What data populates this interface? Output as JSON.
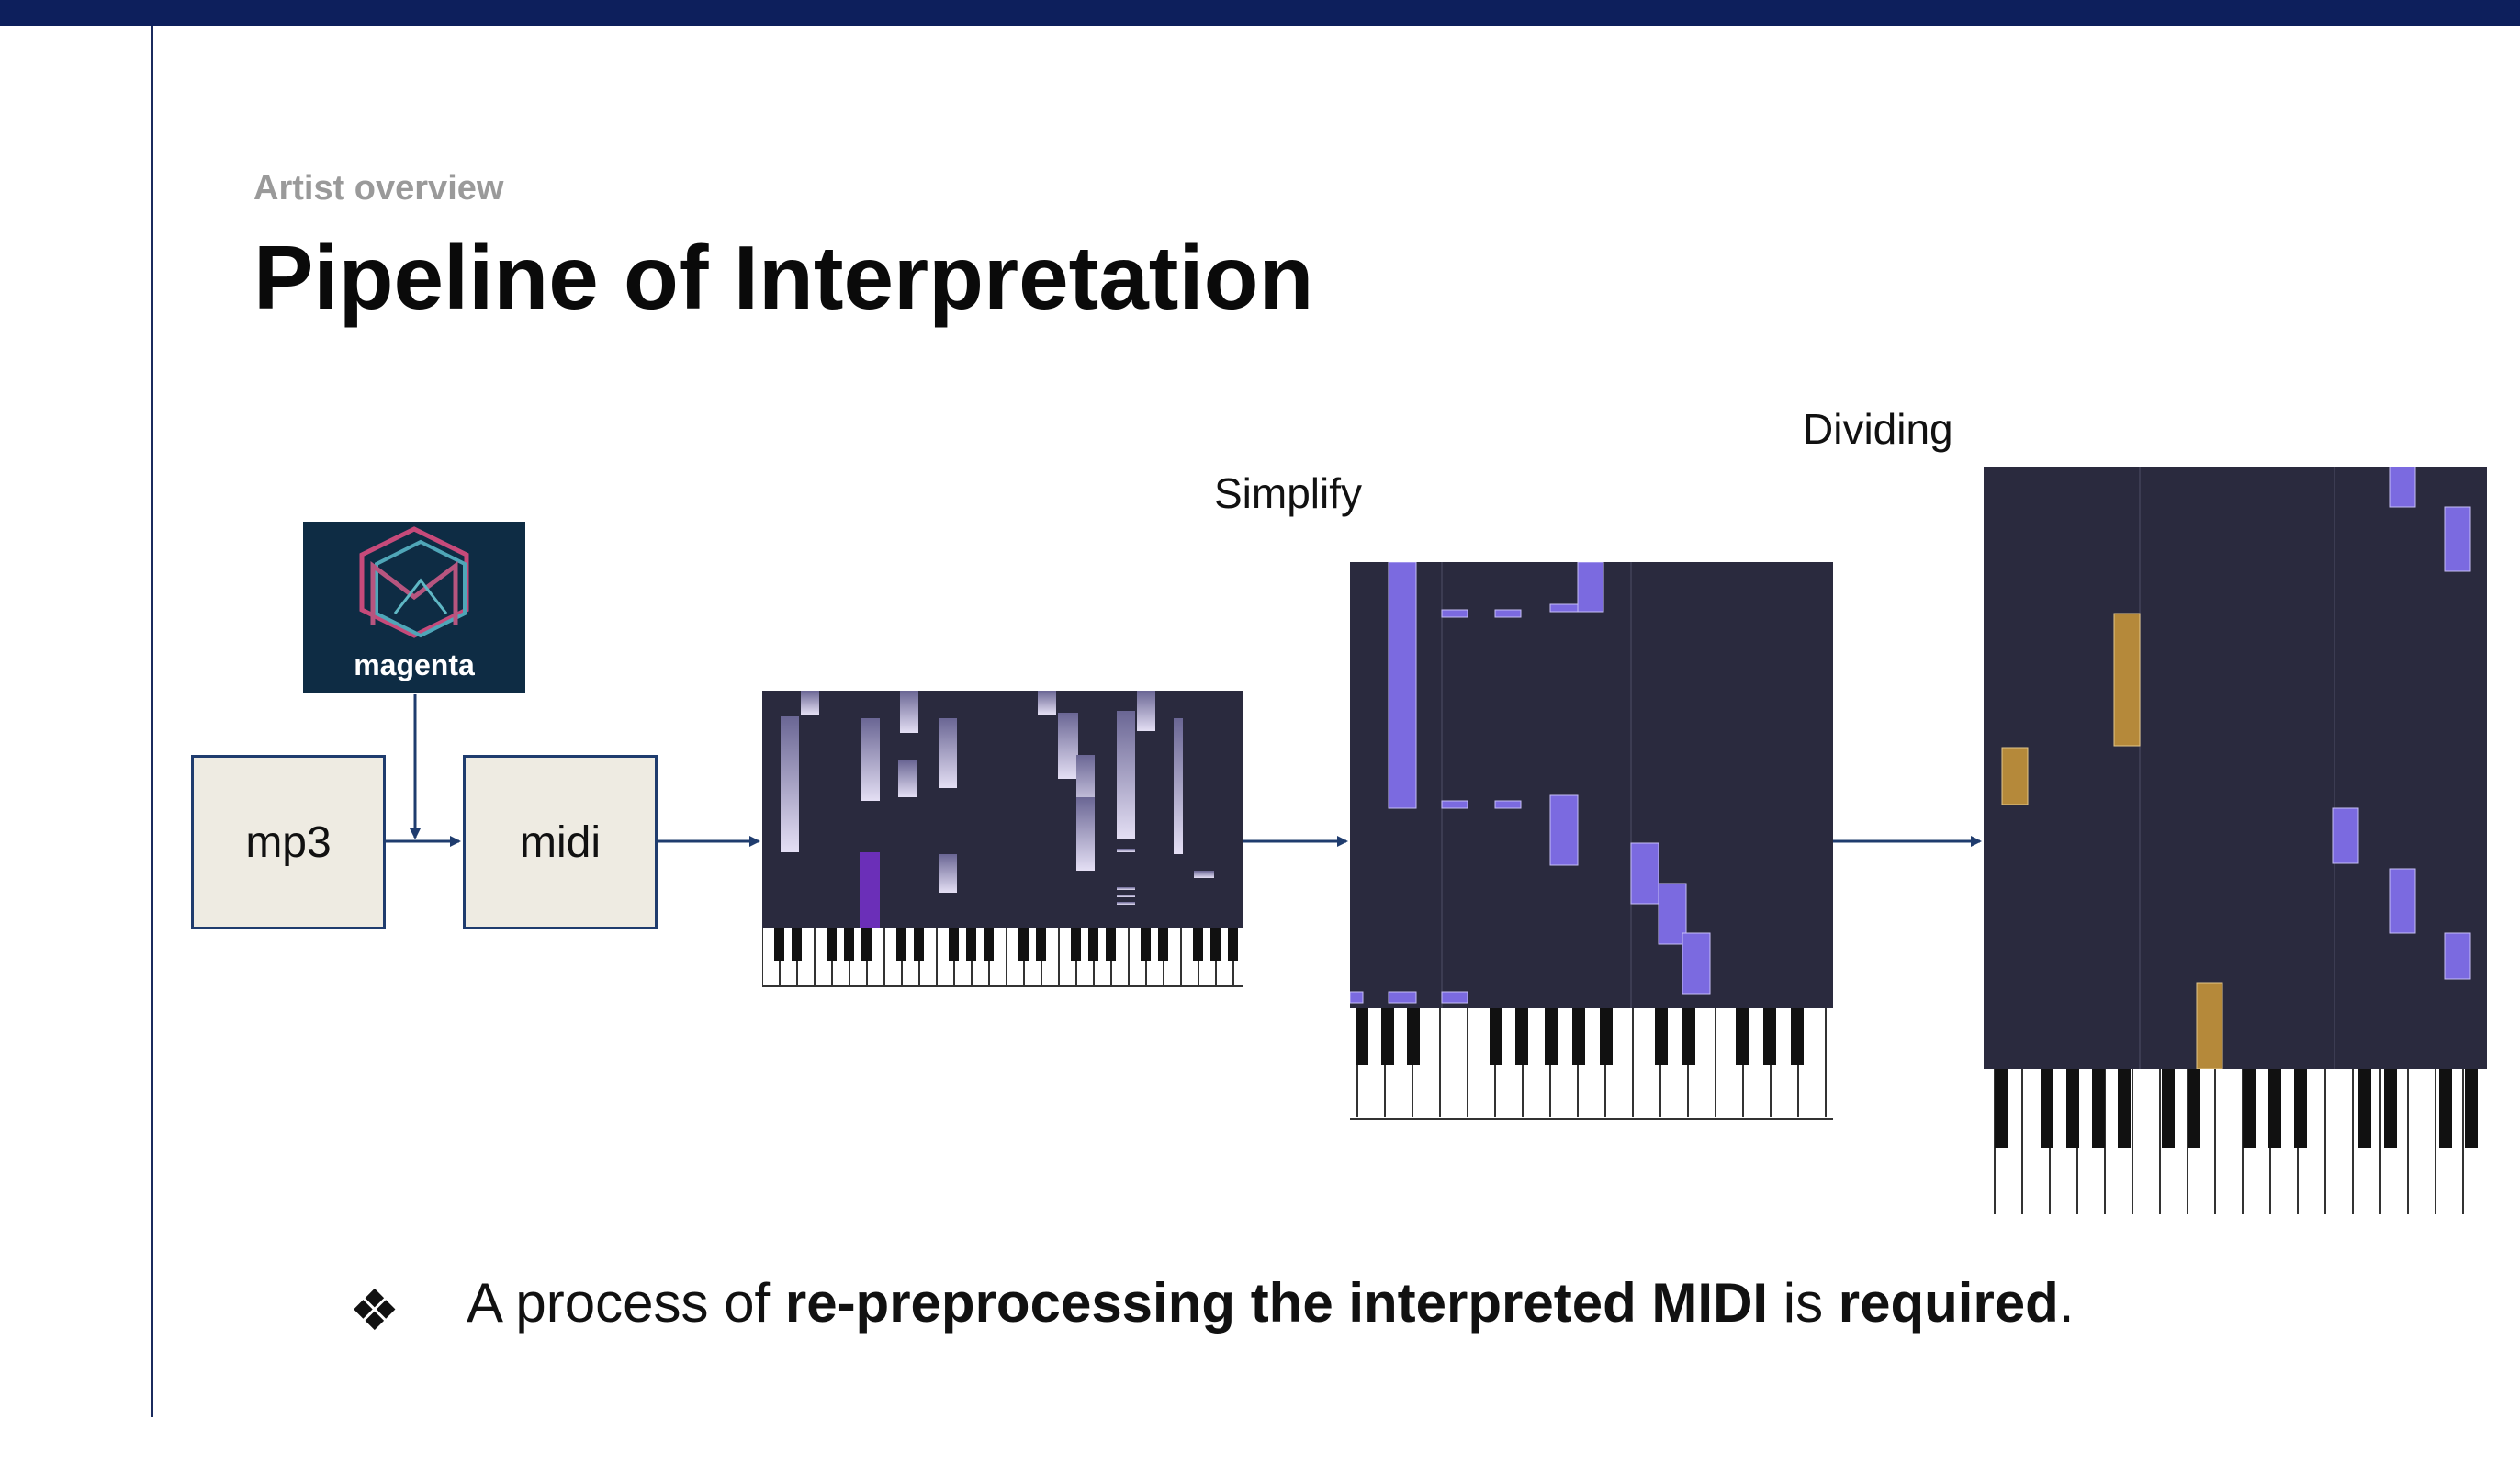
{
  "header": {
    "section": "Artist overview",
    "title": "Pipeline of Interpretation"
  },
  "stages": {
    "simplify": "Simplify",
    "dividing": "Dividing"
  },
  "boxes": {
    "mp3": "mp3",
    "midi": "midi"
  },
  "logo": {
    "text": "magenta"
  },
  "icons": {
    "bullet": "four-diamond-bullet-icon",
    "logo": "magenta-logo-icon"
  },
  "bullet": {
    "prefix": "A process of ",
    "bold1": "re-preprocessing the interpreted MIDI",
    "middle": " is ",
    "bold2": "required",
    "suffix": "."
  },
  "colors": {
    "top_bar": "#0d1f5c",
    "box_fill": "#eeebe2",
    "box_border": "#1f3c6e",
    "arrow": "#1f3c6e",
    "roll_bg": "#2a2a3e",
    "note_purple": "#7b6ae0",
    "note_gold": "#b5893a",
    "logo_bg": "#0e2c44"
  }
}
